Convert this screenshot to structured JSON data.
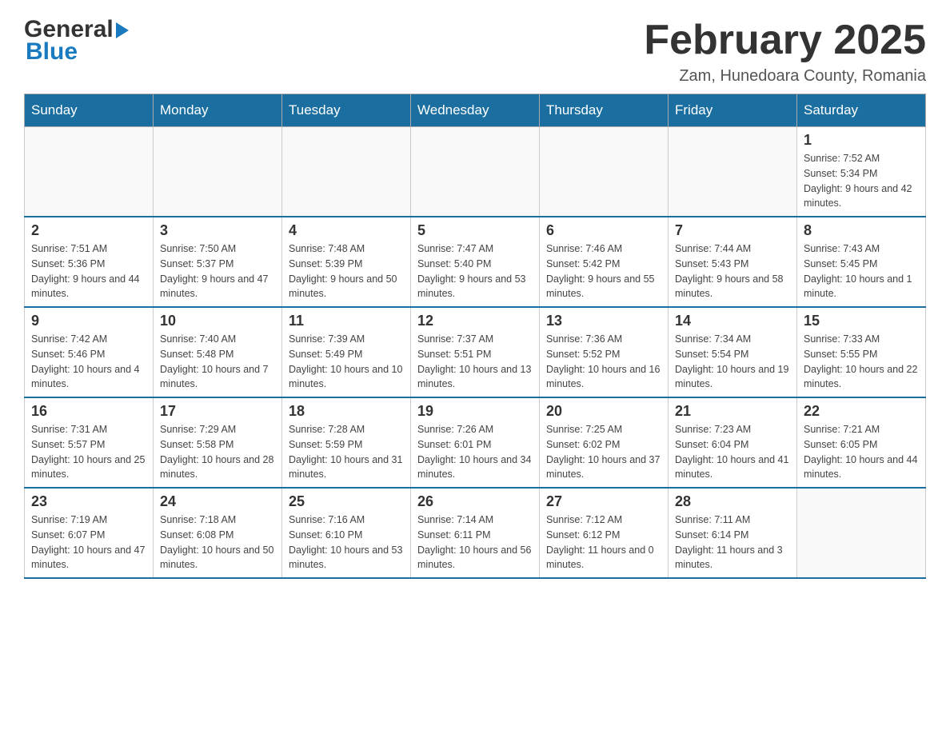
{
  "logo": {
    "general": "General",
    "blue": "Blue",
    "arrow": "▶"
  },
  "header": {
    "title": "February 2025",
    "subtitle": "Zam, Hunedoara County, Romania"
  },
  "weekdays": [
    "Sunday",
    "Monday",
    "Tuesday",
    "Wednesday",
    "Thursday",
    "Friday",
    "Saturday"
  ],
  "weeks": [
    [
      {
        "day": "",
        "info": ""
      },
      {
        "day": "",
        "info": ""
      },
      {
        "day": "",
        "info": ""
      },
      {
        "day": "",
        "info": ""
      },
      {
        "day": "",
        "info": ""
      },
      {
        "day": "",
        "info": ""
      },
      {
        "day": "1",
        "info": "Sunrise: 7:52 AM\nSunset: 5:34 PM\nDaylight: 9 hours and 42 minutes."
      }
    ],
    [
      {
        "day": "2",
        "info": "Sunrise: 7:51 AM\nSunset: 5:36 PM\nDaylight: 9 hours and 44 minutes."
      },
      {
        "day": "3",
        "info": "Sunrise: 7:50 AM\nSunset: 5:37 PM\nDaylight: 9 hours and 47 minutes."
      },
      {
        "day": "4",
        "info": "Sunrise: 7:48 AM\nSunset: 5:39 PM\nDaylight: 9 hours and 50 minutes."
      },
      {
        "day": "5",
        "info": "Sunrise: 7:47 AM\nSunset: 5:40 PM\nDaylight: 9 hours and 53 minutes."
      },
      {
        "day": "6",
        "info": "Sunrise: 7:46 AM\nSunset: 5:42 PM\nDaylight: 9 hours and 55 minutes."
      },
      {
        "day": "7",
        "info": "Sunrise: 7:44 AM\nSunset: 5:43 PM\nDaylight: 9 hours and 58 minutes."
      },
      {
        "day": "8",
        "info": "Sunrise: 7:43 AM\nSunset: 5:45 PM\nDaylight: 10 hours and 1 minute."
      }
    ],
    [
      {
        "day": "9",
        "info": "Sunrise: 7:42 AM\nSunset: 5:46 PM\nDaylight: 10 hours and 4 minutes."
      },
      {
        "day": "10",
        "info": "Sunrise: 7:40 AM\nSunset: 5:48 PM\nDaylight: 10 hours and 7 minutes."
      },
      {
        "day": "11",
        "info": "Sunrise: 7:39 AM\nSunset: 5:49 PM\nDaylight: 10 hours and 10 minutes."
      },
      {
        "day": "12",
        "info": "Sunrise: 7:37 AM\nSunset: 5:51 PM\nDaylight: 10 hours and 13 minutes."
      },
      {
        "day": "13",
        "info": "Sunrise: 7:36 AM\nSunset: 5:52 PM\nDaylight: 10 hours and 16 minutes."
      },
      {
        "day": "14",
        "info": "Sunrise: 7:34 AM\nSunset: 5:54 PM\nDaylight: 10 hours and 19 minutes."
      },
      {
        "day": "15",
        "info": "Sunrise: 7:33 AM\nSunset: 5:55 PM\nDaylight: 10 hours and 22 minutes."
      }
    ],
    [
      {
        "day": "16",
        "info": "Sunrise: 7:31 AM\nSunset: 5:57 PM\nDaylight: 10 hours and 25 minutes."
      },
      {
        "day": "17",
        "info": "Sunrise: 7:29 AM\nSunset: 5:58 PM\nDaylight: 10 hours and 28 minutes."
      },
      {
        "day": "18",
        "info": "Sunrise: 7:28 AM\nSunset: 5:59 PM\nDaylight: 10 hours and 31 minutes."
      },
      {
        "day": "19",
        "info": "Sunrise: 7:26 AM\nSunset: 6:01 PM\nDaylight: 10 hours and 34 minutes."
      },
      {
        "day": "20",
        "info": "Sunrise: 7:25 AM\nSunset: 6:02 PM\nDaylight: 10 hours and 37 minutes."
      },
      {
        "day": "21",
        "info": "Sunrise: 7:23 AM\nSunset: 6:04 PM\nDaylight: 10 hours and 41 minutes."
      },
      {
        "day": "22",
        "info": "Sunrise: 7:21 AM\nSunset: 6:05 PM\nDaylight: 10 hours and 44 minutes."
      }
    ],
    [
      {
        "day": "23",
        "info": "Sunrise: 7:19 AM\nSunset: 6:07 PM\nDaylight: 10 hours and 47 minutes."
      },
      {
        "day": "24",
        "info": "Sunrise: 7:18 AM\nSunset: 6:08 PM\nDaylight: 10 hours and 50 minutes."
      },
      {
        "day": "25",
        "info": "Sunrise: 7:16 AM\nSunset: 6:10 PM\nDaylight: 10 hours and 53 minutes."
      },
      {
        "day": "26",
        "info": "Sunrise: 7:14 AM\nSunset: 6:11 PM\nDaylight: 10 hours and 56 minutes."
      },
      {
        "day": "27",
        "info": "Sunrise: 7:12 AM\nSunset: 6:12 PM\nDaylight: 11 hours and 0 minutes."
      },
      {
        "day": "28",
        "info": "Sunrise: 7:11 AM\nSunset: 6:14 PM\nDaylight: 11 hours and 3 minutes."
      },
      {
        "day": "",
        "info": ""
      }
    ]
  ]
}
